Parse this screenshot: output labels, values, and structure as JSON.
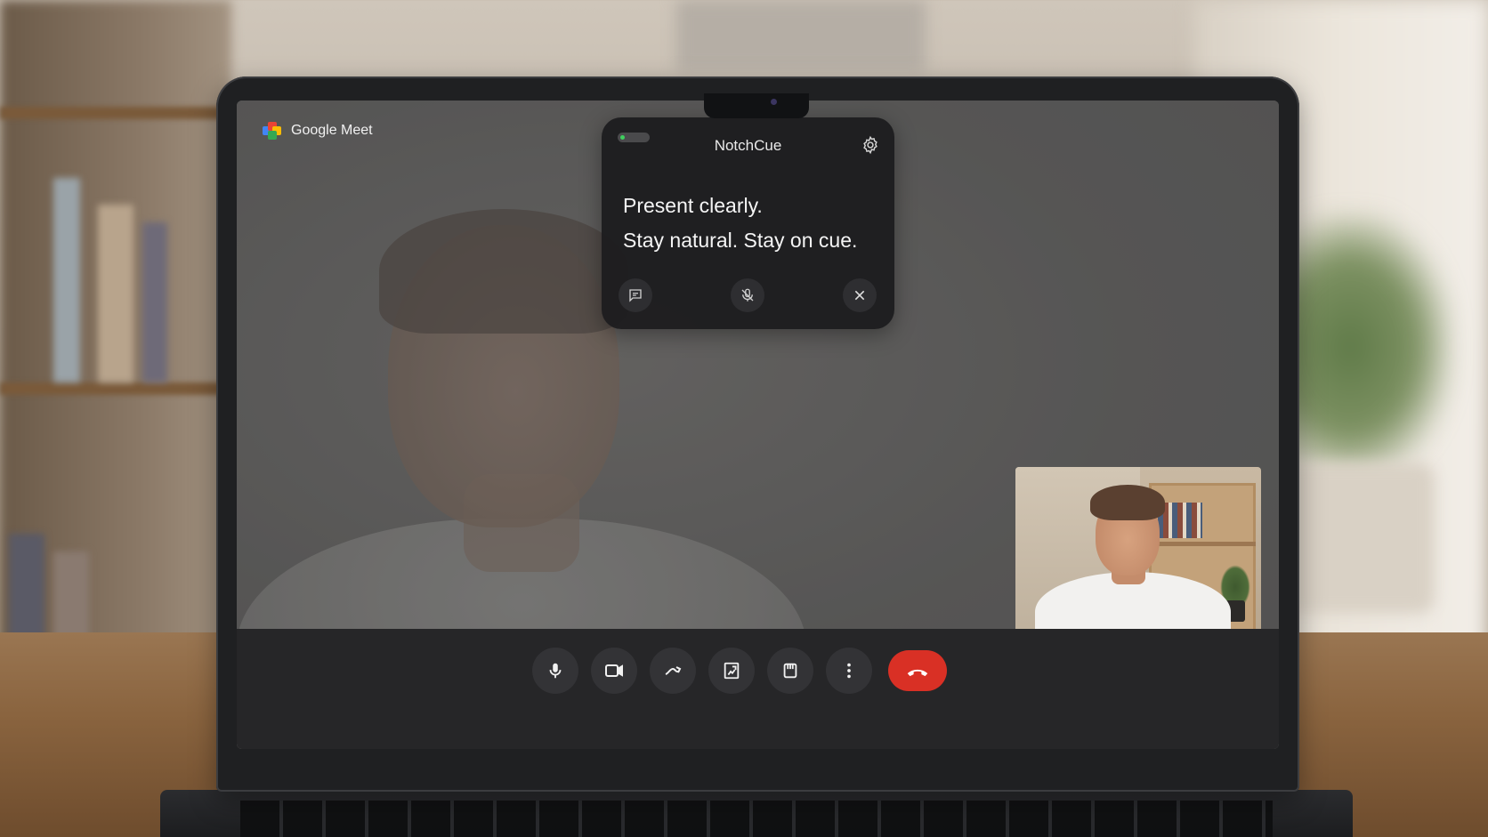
{
  "app": {
    "brand_name": "Google Meet",
    "brand_colors": [
      "#ea4335",
      "#fbbc04",
      "#34a853",
      "#4285f4"
    ]
  },
  "notchcue": {
    "title": "NotchCue",
    "toggle_on": true,
    "lines": [
      "Present clearly.",
      "Stay natural. Stay on cue."
    ],
    "actions": [
      "chat-icon",
      "mic-off-icon",
      "close-icon"
    ],
    "settings_icon": "gear-icon"
  },
  "controls": [
    {
      "name": "microphone",
      "icon": "mic-icon"
    },
    {
      "name": "camera",
      "icon": "video-camera-icon"
    },
    {
      "name": "share",
      "icon": "link-icon"
    },
    {
      "name": "present",
      "icon": "present-icon"
    },
    {
      "name": "raise-hand",
      "icon": "hand-icon"
    },
    {
      "name": "more-options",
      "icon": "more-vert-icon"
    },
    {
      "name": "leave-call",
      "icon": "phone-hangup-icon",
      "color": "#d93025"
    }
  ]
}
